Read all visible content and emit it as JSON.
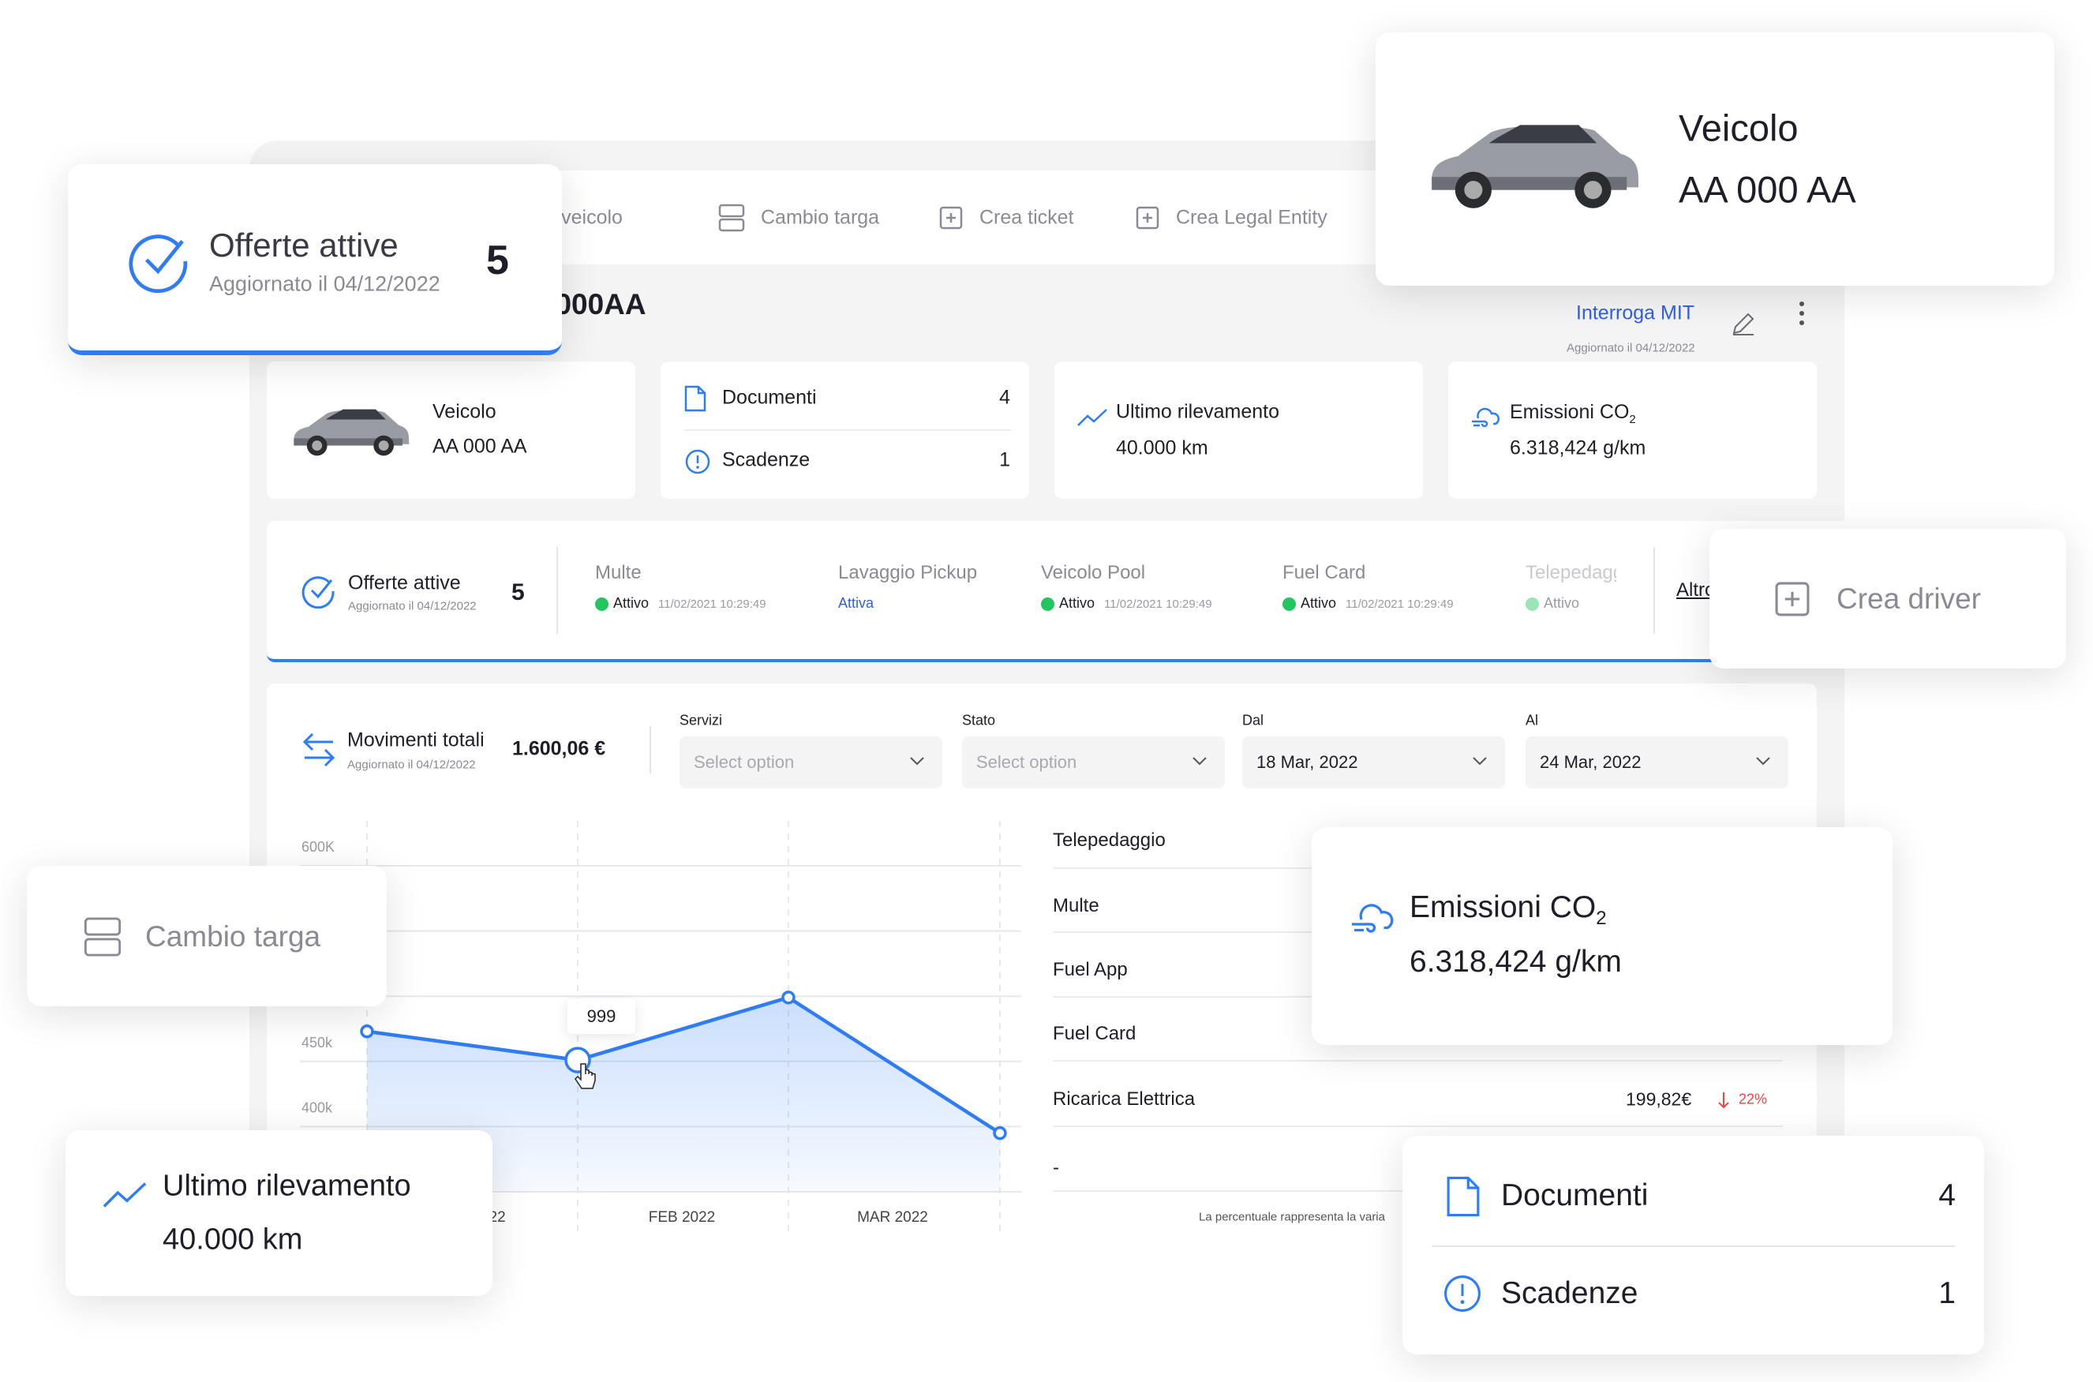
{
  "toolbar": {
    "items": [
      {
        "label": "Crea veicolo",
        "icon": "car-icon"
      },
      {
        "label": "Cambio targa",
        "icon": "plate-icon"
      },
      {
        "label": "Crea ticket",
        "icon": "plus-square-icon"
      },
      {
        "label": "Crea Legal Entity",
        "icon": "plus-square-icon"
      }
    ]
  },
  "header": {
    "title": "AA000AA",
    "mit_link": "Interroga MIT",
    "updated": "Aggiornato il 04/12/2022"
  },
  "summary": {
    "vehicle": {
      "label": "Veicolo",
      "plate": "AA 000 AA"
    },
    "documents": {
      "label": "Documenti",
      "count": "4",
      "deadlines_label": "Scadenze",
      "deadlines_count": "1"
    },
    "last_reading": {
      "label": "Ultimo rilevamento",
      "value": "40.000 km"
    },
    "emissions": {
      "label": "Emissioni CO",
      "sub": "2",
      "value": "6.318,424 g/km"
    }
  },
  "services": {
    "offers": {
      "label": "Offerte attive",
      "updated": "Aggiornato il 04/12/2022",
      "count": "5"
    },
    "items": [
      {
        "label": "Multe",
        "status": "Attivo",
        "time": "11/02/2021 10:29:49"
      },
      {
        "label": "Lavaggio Pickup",
        "status": "Attiva"
      },
      {
        "label": "Veicolo Pool",
        "status": "Attivo",
        "time": "11/02/2021 10:29:49"
      },
      {
        "label": "Fuel Card",
        "status": "Attivo",
        "time": "11/02/2021 10:29:49"
      },
      {
        "label": "Telepedaggio",
        "status": "Attivo"
      }
    ],
    "more": "Altro",
    "status_color": "#22c55e"
  },
  "movements": {
    "label": "Movimenti totali",
    "updated": "Aggiornato il 04/12/2022",
    "total": "1.600,06 €",
    "filters": [
      {
        "label": "Servizi",
        "value": "Select option",
        "placeholder": true
      },
      {
        "label": "Stato",
        "value": "Select option",
        "placeholder": true
      },
      {
        "label": "Dal",
        "value": "18 Mar, 2022"
      },
      {
        "label": "Al",
        "value": "24 Mar, 2022"
      }
    ],
    "list": [
      {
        "label": "Telepedaggio"
      },
      {
        "label": "Multe"
      },
      {
        "label": "Fuel App"
      },
      {
        "label": "Fuel Card"
      },
      {
        "label": "Ricarica Elettrica",
        "value": "199,82€",
        "change": "22%",
        "direction": "down"
      },
      {
        "label": "-"
      }
    ],
    "footnote": "La percentuale rappresenta la varia"
  },
  "chart_data": {
    "type": "area",
    "categories": [
      "JAN 2022",
      "FEB 2022",
      "MAR 2022"
    ],
    "y_ticks": [
      "600K",
      "450k",
      "400k"
    ],
    "ylim": [
      350000,
      600000
    ],
    "points": [
      473000,
      451000,
      499000,
      395000
    ],
    "tooltip": "999",
    "grid": true,
    "color": "#2e7cf6"
  },
  "floating": {
    "offers": {
      "label": "Offerte attive",
      "updated": "Aggiornato il 04/12/2022",
      "count": "5"
    },
    "vehicle": {
      "label": "Veicolo",
      "plate": "AA 000 AA"
    },
    "create_driver": "Crea driver",
    "change_plate": "Cambio targa",
    "emissions": {
      "label": "Emissioni CO",
      "sub": "2",
      "value": "6.318,424 g/km"
    },
    "last_reading": {
      "label": "Ultimo rilevamento",
      "value": "40.000 km"
    },
    "documents": {
      "label": "Documenti",
      "count": "4",
      "deadlines_label": "Scadenze",
      "deadlines_count": "1"
    }
  },
  "colors": {
    "accent": "#2e7cf6",
    "link": "#2f5ee8",
    "negative": "#ef4444",
    "background": "#f4f4f5"
  }
}
